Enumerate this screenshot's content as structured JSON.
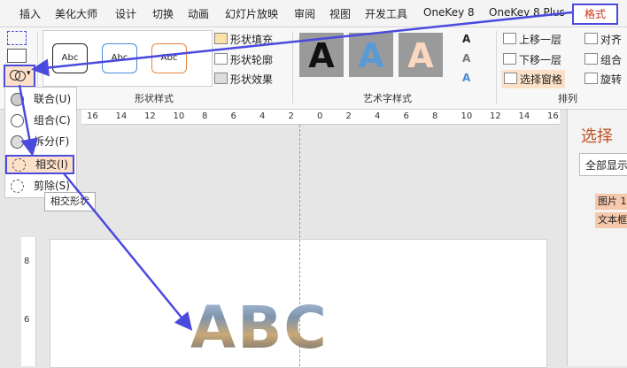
{
  "tabs": [
    "插入",
    "美化大师",
    "设计",
    "切换",
    "动画",
    "幻灯片放映",
    "审阅",
    "视图",
    "开发工具",
    "OneKey 8",
    "OneKey 8 Plus",
    "格式"
  ],
  "shape_styles": {
    "previews": [
      "Abc",
      "Abc",
      "Abc"
    ],
    "fill_label": "形状填充",
    "outline_label": "形状轮廓",
    "effects_label": "形状效果",
    "group_label": "形状样式"
  },
  "wordart": {
    "previews": [
      "A",
      "A",
      "A"
    ],
    "group_label": "艺术字样式"
  },
  "arrange": {
    "bring_forward": "上移一层",
    "send_backward": "下移一层",
    "selection_pane": "选择窗格",
    "align": "对齐",
    "group": "组合",
    "rotate": "旋转",
    "group_label": "排列"
  },
  "merge_menu": {
    "items": [
      "联合(U)",
      "组合(C)",
      "拆分(F)",
      "相交(I)",
      "剪除(S)"
    ],
    "tooltip": "相交形状"
  },
  "ruler": {
    "h": [
      "16",
      "14",
      "12",
      "10",
      "8",
      "6",
      "4",
      "2",
      "0",
      "2",
      "4",
      "6",
      "8",
      "10",
      "12",
      "14",
      "16"
    ],
    "v": [
      "8",
      "6"
    ]
  },
  "slide": {
    "text": "ABC"
  },
  "selection_pane": {
    "title": "选择",
    "show_all": "全部显示",
    "items": [
      "图片 1",
      "文本框"
    ]
  },
  "colors": {
    "accent": "#4a4adf",
    "highlight": "#fde0c8",
    "title": "#c0501e"
  }
}
